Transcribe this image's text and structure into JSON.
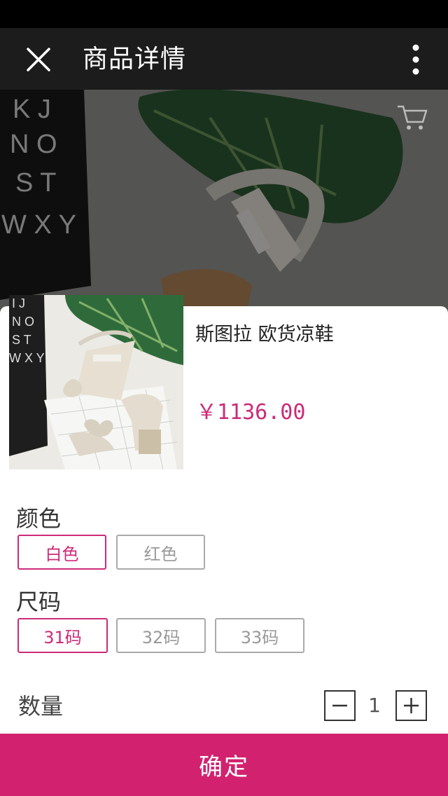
{
  "header": {
    "title": "商品详情",
    "close_icon": "close-icon",
    "more_icon": "more-vertical-icon"
  },
  "hero": {
    "cart_icon": "cart-icon"
  },
  "product": {
    "name": "斯图拉 欧货凉鞋",
    "price": "￥1136.00"
  },
  "color_section": {
    "label": "颜色",
    "options": [
      {
        "label": "白色",
        "selected": true
      },
      {
        "label": "红色",
        "selected": false
      }
    ]
  },
  "size_section": {
    "label": "尺码",
    "options": [
      {
        "label": "31码",
        "selected": true
      },
      {
        "label": "32码",
        "selected": false
      },
      {
        "label": "33码",
        "selected": false
      }
    ]
  },
  "quantity": {
    "label": "数量",
    "value": "1"
  },
  "confirm_label": "确定",
  "colors": {
    "accent": "#d2226f",
    "price": "#cc2b78",
    "nav_bg": "#1c1c1c"
  }
}
